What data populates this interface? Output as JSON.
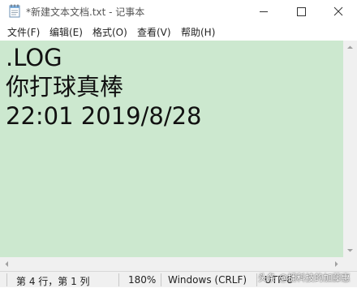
{
  "window": {
    "title": "*新建文本文档.txt - 记事本"
  },
  "menu": {
    "items": [
      {
        "label": "文件(F)"
      },
      {
        "label": "编辑(E)"
      },
      {
        "label": "格式(O)"
      },
      {
        "label": "查看(V)"
      },
      {
        "label": "帮助(H)"
      }
    ]
  },
  "editor": {
    "lines": [
      ".LOG",
      "你打球真棒",
      "22:01 2019/8/28"
    ],
    "background_color": "#cce8cf"
  },
  "status": {
    "position": "第 4 行，第 1 列",
    "zoom": "180%",
    "line_ending": "Windows (CRLF)",
    "encoding": "UTF-8"
  },
  "watermark": {
    "text": "头条 @播科技的加藤惠"
  },
  "icons": {
    "app": "notepad-icon",
    "minimize": "minimize-icon",
    "maximize": "maximize-icon",
    "close": "close-icon"
  }
}
